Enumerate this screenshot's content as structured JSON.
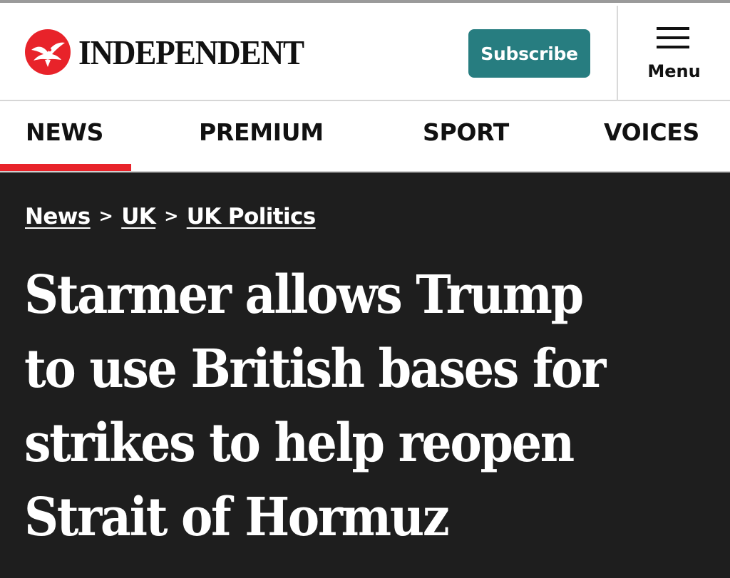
{
  "header": {
    "brand_name": "INDEPENDENT",
    "logo_icon": "eagle-logo-icon",
    "brand_color": "#e8232a",
    "subscribe_label": "Subscribe",
    "subscribe_color": "#277d80",
    "menu_label": "Menu"
  },
  "nav": {
    "items": [
      {
        "label": "NEWS",
        "active": true
      },
      {
        "label": "PREMIUM",
        "active": false
      },
      {
        "label": "SPORT",
        "active": false
      },
      {
        "label": "VOICES",
        "active": false
      }
    ],
    "active_color": "#e8232a"
  },
  "article": {
    "breadcrumb": [
      "News",
      "UK",
      "UK Politics"
    ],
    "breadcrumb_separator": ">",
    "headline": "Starmer allows Trump to use British bases for strikes to help reopen Strait of Hormuz",
    "background_color": "#1e1e1e"
  }
}
